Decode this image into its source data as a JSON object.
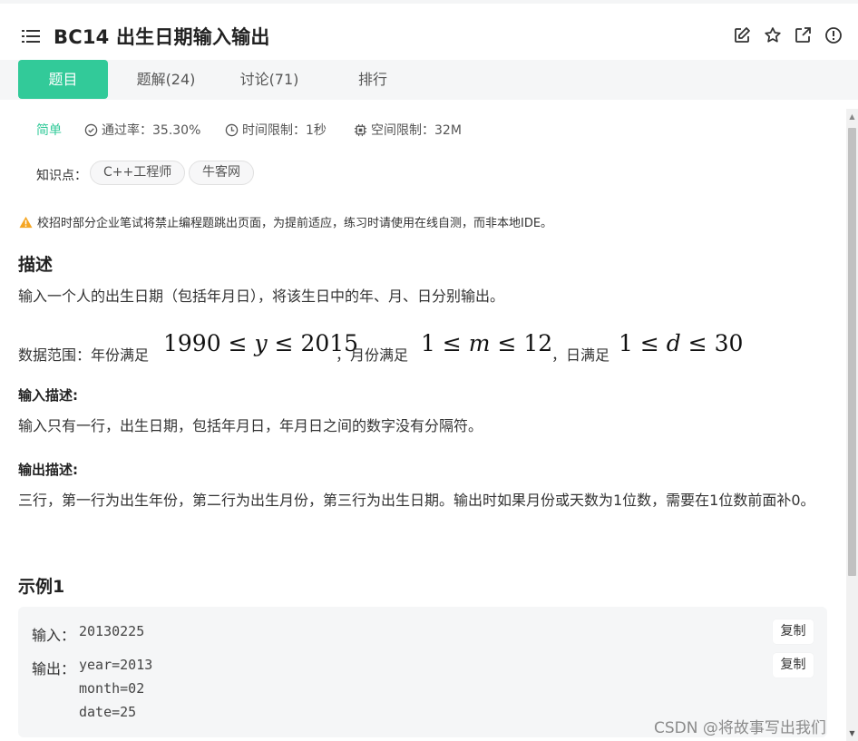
{
  "header": {
    "title": "BC14  出生日期输入输出",
    "icons": [
      "edit-icon",
      "star-icon",
      "external-link-icon",
      "info-icon"
    ]
  },
  "tabs": [
    {
      "label": "题目",
      "active": true
    },
    {
      "label": "题解(24)",
      "active": false
    },
    {
      "label": "讨论(71)",
      "active": false
    },
    {
      "label": "排行",
      "active": false
    }
  ],
  "meta": {
    "difficulty": "简单",
    "pass_rate": "通过率：35.30%",
    "time_limit": "时间限制：1秒",
    "memory_limit": "空间限制：32M"
  },
  "knowledge": {
    "label": "知识点：",
    "tags": [
      "C++工程师",
      "牛客网"
    ]
  },
  "warning": "校招时部分企业笔试将禁止编程题跳出页面，为提前适应，练习时请使用在线自测，而非本地IDE。",
  "description": {
    "heading": "描述",
    "text": "输入一个人的出生日期（包括年月日），将该生日中的年、月、日分别输出。",
    "range_prefix": "数据范围：年份满足",
    "range_year": {
      "low": "1990",
      "var": "y",
      "high": "2015"
    },
    "range_month_prefix": "，月份满足",
    "range_month": {
      "low": "1",
      "var": "m",
      "high": "12"
    },
    "range_day_prefix": "，日满足",
    "range_day": {
      "low": "1",
      "var": "d",
      "high": "30"
    },
    "leq": "≤"
  },
  "input_desc": {
    "heading": "输入描述:",
    "text": "输入只有一行，出生日期，包括年月日，年月日之间的数字没有分隔符。"
  },
  "output_desc": {
    "heading": "输出描述:",
    "text": "三行，第一行为出生年份，第二行为出生月份，第三行为出生日期。输出时如果月份或天数为1位数，需要在1位数前面补0。"
  },
  "example": {
    "heading": "示例1",
    "input_label": "输入：",
    "input_value": "20130225",
    "output_label": "输出：",
    "output_value": "year=2013\nmonth=02\ndate=25",
    "copy_label": "复制"
  },
  "watermark": "CSDN @将故事写出我们",
  "colors": {
    "accent": "#32ca99",
    "warning": "#f5a623"
  }
}
